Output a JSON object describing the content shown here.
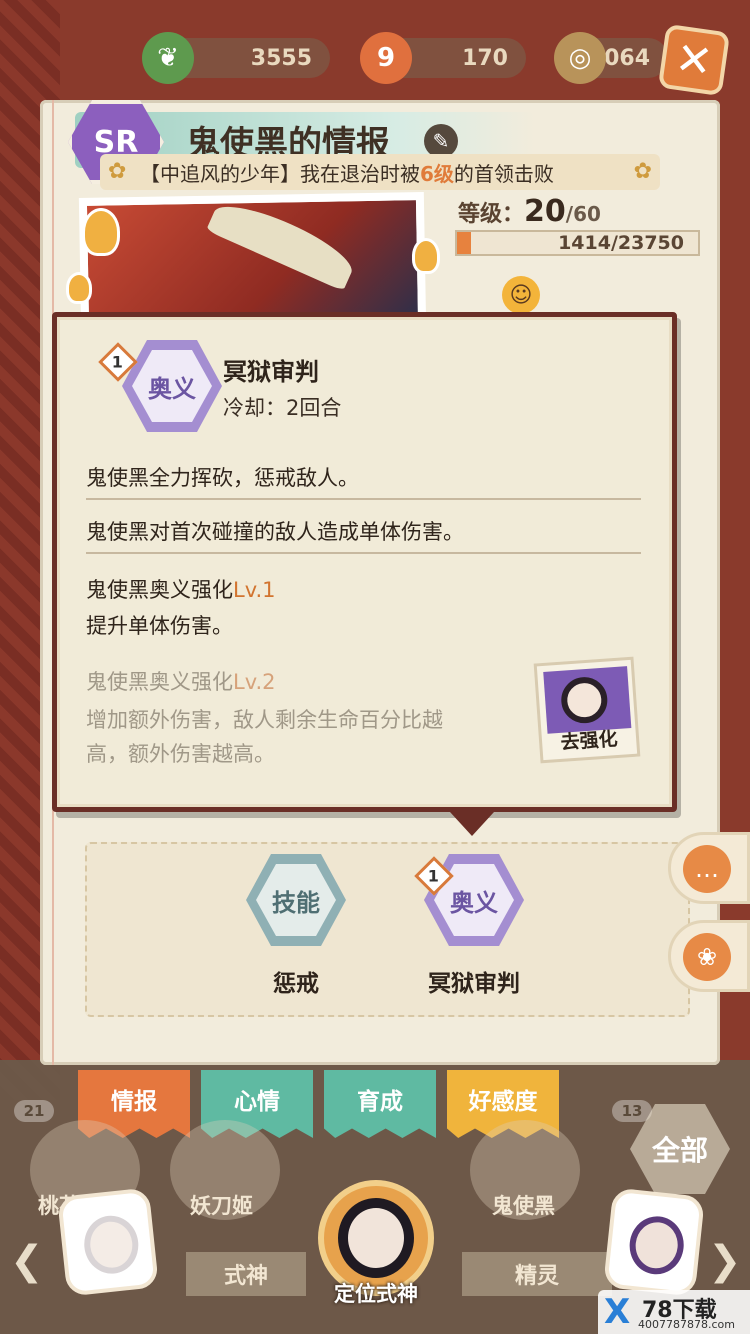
{
  "resources": [
    {
      "icon": "pine-icon",
      "value": "3555"
    },
    {
      "icon": "stamina-icon",
      "value": "170"
    },
    {
      "icon": "coin-icon",
      "value": "4064"
    }
  ],
  "header": {
    "rarity": "SR",
    "title": "鬼使黑的情报",
    "subtitle_prefix": "【中追风的少年】我在退治时被",
    "subtitle_highlight": "6级",
    "subtitle_suffix": "的首领击败"
  },
  "level": {
    "label": "等级：",
    "current": "20",
    "max": "/60",
    "exp_text": "1414/23750",
    "exp_fraction": 0.06
  },
  "popup": {
    "badge_number": "1",
    "hex_label": "奥义",
    "skill_name": "冥狱审判",
    "cooldown": "冷却：2回合",
    "desc1": "鬼使黑全力挥砍，惩戒敌人。",
    "desc2": "鬼使黑对首次碰撞的敌人造成单体伤害。",
    "enh1_title": "鬼使黑奥义强化",
    "enh1_lv": "Lv.1",
    "enh1_desc": "提升单体伤害。",
    "enh2_title": "鬼使黑奥义强化",
    "enh2_lv": "Lv.2",
    "enh2_desc1": "增加额外伤害，敌人剩余生命百分比越",
    "enh2_desc2": "高，额外伤害越高。",
    "enhance_button": "去强化"
  },
  "skills": [
    {
      "hex": "技能",
      "name": "惩戒"
    },
    {
      "hex": "奥义",
      "name": "冥狱审判",
      "badge": "1"
    }
  ],
  "tabs": [
    {
      "label": "情报",
      "color": "#e5773e"
    },
    {
      "label": "心情",
      "color": "#5fbaa2"
    },
    {
      "label": "育成",
      "color": "#5fbaa2"
    },
    {
      "label": "好感度",
      "color": "#f0b43c"
    }
  ],
  "roster": [
    {
      "name": "桃花妖",
      "count": "21"
    },
    {
      "name": "妖刀姬",
      "count": ""
    },
    {
      "name": "鬼使黑",
      "count": "13"
    }
  ],
  "roster_all": "全部",
  "bottom_tabs": [
    "式神",
    "精灵"
  ],
  "locate_label": "定位式神",
  "watermark": {
    "brand": "78下载",
    "url": "4007787878.com"
  }
}
